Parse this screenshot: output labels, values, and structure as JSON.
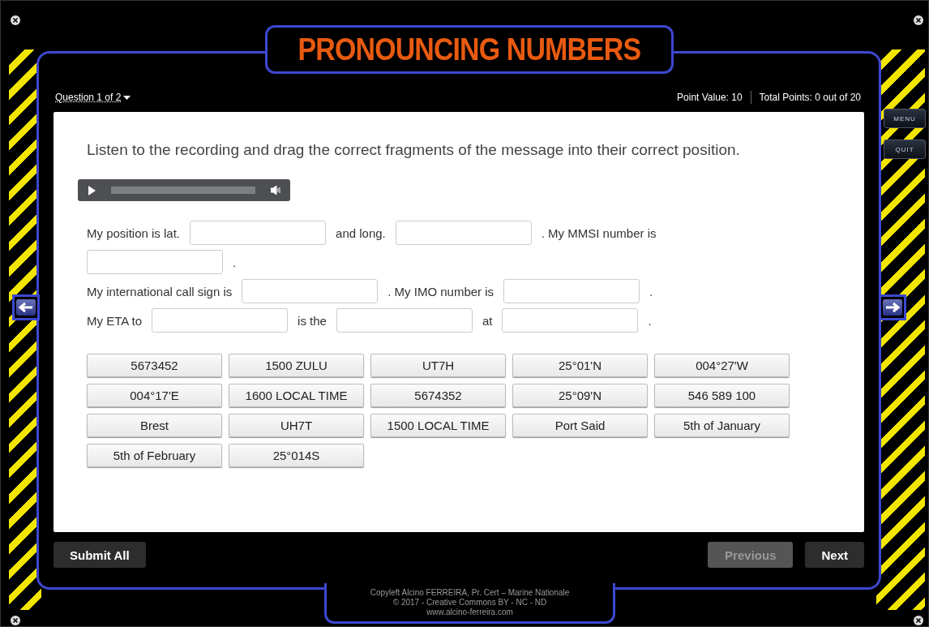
{
  "title": "PRONOUNCING NUMBERS",
  "question_menu": {
    "label": "Question 1 of 2"
  },
  "point_value": "Point Value: 10",
  "total_points": "Total Points: 0 out of 20",
  "side_buttons": [
    {
      "label": "MENU"
    },
    {
      "label": "QUIT"
    }
  ],
  "prompt": "Listen to the recording and drag the correct fragments of the message into their correct position.",
  "sentence_lines": [
    [
      {
        "kind": "text",
        "text": "My position is lat."
      },
      {
        "kind": "blank"
      },
      {
        "kind": "text",
        "text": "and long."
      },
      {
        "kind": "blank"
      },
      {
        "kind": "text",
        "text": ". My MMSI number is"
      }
    ],
    [
      {
        "kind": "blank"
      },
      {
        "kind": "text",
        "text": "."
      }
    ],
    [
      {
        "kind": "text",
        "text": "My international call sign is"
      },
      {
        "kind": "blank"
      },
      {
        "kind": "text",
        "text": ". My IMO number is"
      },
      {
        "kind": "blank"
      },
      {
        "kind": "text",
        "text": "."
      }
    ],
    [
      {
        "kind": "text",
        "text": "My ETA to"
      },
      {
        "kind": "blank"
      },
      {
        "kind": "text",
        "text": "is the"
      },
      {
        "kind": "blank"
      },
      {
        "kind": "text",
        "text": "at"
      },
      {
        "kind": "blank"
      },
      {
        "kind": "text",
        "text": "."
      }
    ]
  ],
  "fragments": [
    "5673452",
    "1500 ZULU",
    "UT7H",
    "25°01'N",
    "004°27'W",
    "004°17'E",
    "1600 LOCAL TIME",
    "5674352",
    "25°09'N",
    "546 589 100",
    "Brest",
    "UH7T",
    "1500 LOCAL TIME",
    "Port Said",
    "5th of January",
    "5th of February",
    "25°014S"
  ],
  "submit_button": {
    "label": "Submit All"
  },
  "nav_buttons": [
    {
      "label": "Previous",
      "disabled": true
    },
    {
      "label": "Next",
      "disabled": false
    }
  ],
  "footer_lines": [
    "Copyleft Alcino FERREIRA, Pr. Cert – Marine Nationale",
    "© 2017 - Creative Commons BY - NC - ND",
    "www.alcino-ferreira.com"
  ]
}
